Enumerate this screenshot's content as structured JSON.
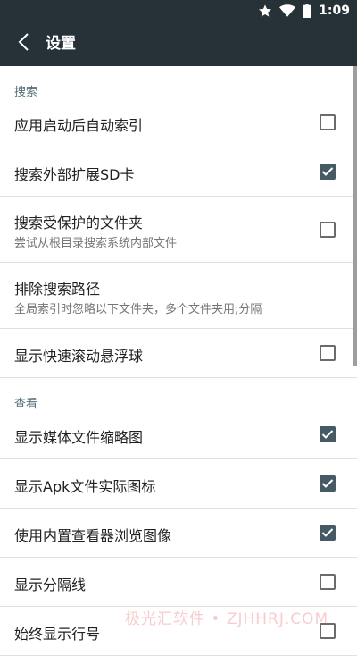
{
  "status_bar": {
    "time": "1:09",
    "icons": [
      "star-icon",
      "wifi-icon",
      "battery-icon"
    ]
  },
  "app_bar": {
    "title": "设置",
    "back_icon": "back-arrow-icon"
  },
  "sections": {
    "search": {
      "header": "搜索",
      "auto_index": {
        "title": "应用启动后自动索引",
        "checked": false
      },
      "external_sd": {
        "title": "搜索外部扩展SD卡",
        "checked": true
      },
      "protected_folders": {
        "title": "搜索受保护的文件夹",
        "summary": "尝试从根目录搜索系统内部文件",
        "checked": false
      },
      "exclude_paths": {
        "title": "排除搜索路径",
        "summary": "全局索引时忽略以下文件夹，多个文件夹用;分隔"
      },
      "fast_scroll": {
        "title": "显示快速滚动悬浮球",
        "checked": false
      }
    },
    "view": {
      "header": "查看",
      "media_thumbs": {
        "title": "显示媒体文件缩略图",
        "checked": true
      },
      "apk_icons": {
        "title": "显示Apk文件实际图标",
        "checked": true
      },
      "builtin_viewer": {
        "title": "使用内置查看器浏览图像",
        "checked": true
      },
      "dividers": {
        "title": "显示分隔线",
        "checked": false
      },
      "line_numbers": {
        "title": "始终显示行号",
        "checked": false
      }
    }
  },
  "watermark": "极光汇软件 • ZJHHRJ.COM",
  "colors": {
    "bar": "#263238",
    "accent": "#455a64",
    "section_header": "#546e7a"
  }
}
